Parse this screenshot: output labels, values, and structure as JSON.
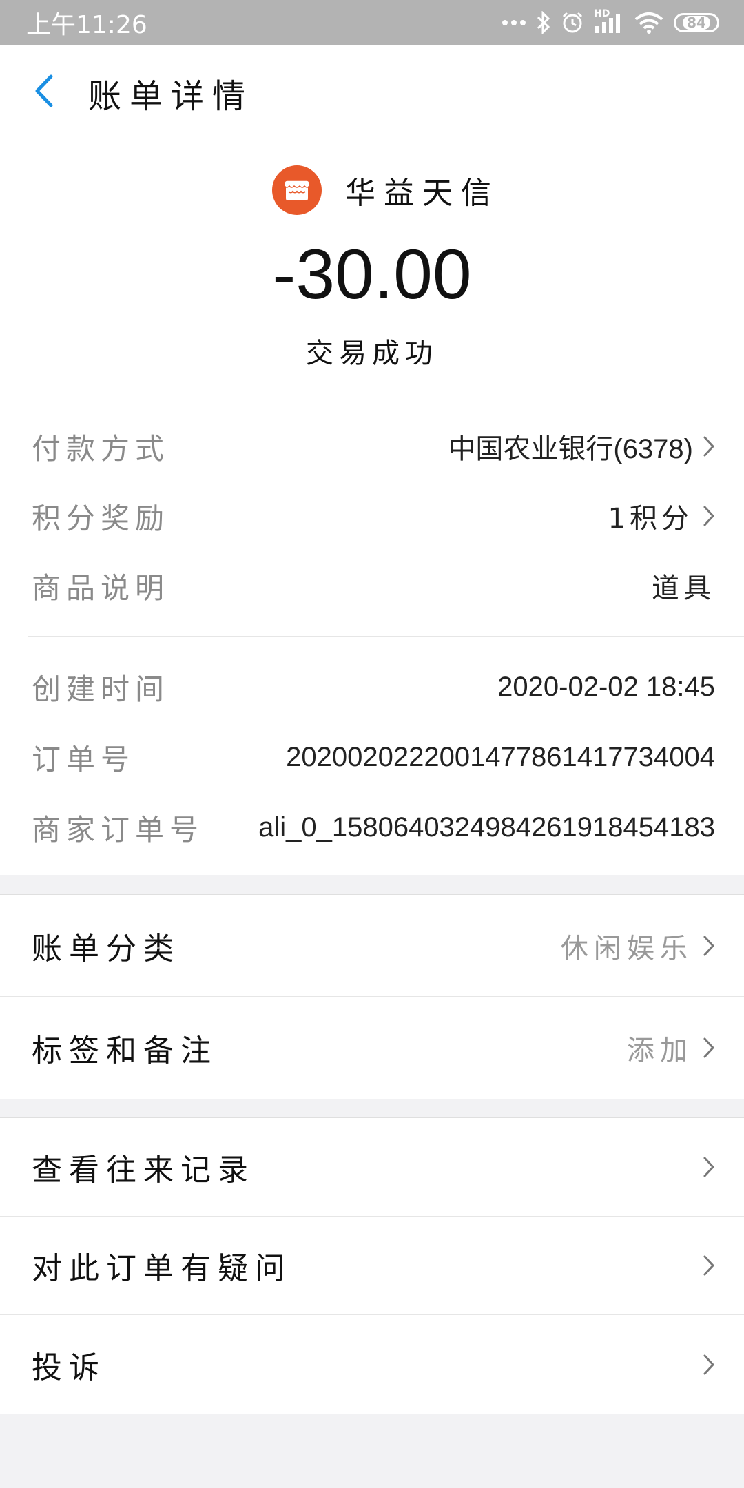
{
  "status_bar": {
    "time": "上午11:26",
    "network_label": "HD",
    "battery": "84"
  },
  "header": {
    "title": "账单详情"
  },
  "summary": {
    "merchant_name": "华益天信",
    "amount": "-30.00",
    "status": "交易成功"
  },
  "details": [
    {
      "label": "付款方式",
      "value": "中国农业银行(6378)"
    },
    {
      "label": "积分奖励",
      "value": "1积分"
    },
    {
      "label": "商品说明",
      "value": "道具"
    },
    {
      "label": "创建时间",
      "value": "2020-02-02 18:45"
    },
    {
      "label": "订单号",
      "value": "2020020222001477861417734004"
    },
    {
      "label": "商家订单号",
      "value": "ali_0_1580640324984261918454183"
    }
  ],
  "category_group": [
    {
      "label": "账单分类",
      "value": "休闲娱乐"
    },
    {
      "label": "标签和备注",
      "value": "添加"
    }
  ],
  "action_group": [
    {
      "label": "查看往来记录"
    },
    {
      "label": "对此订单有疑问"
    },
    {
      "label": "投诉"
    }
  ],
  "colors": {
    "accent_blue": "#1a8fe3",
    "merchant_logo": "#e8592a",
    "status_bar": "#b3b3b3"
  }
}
